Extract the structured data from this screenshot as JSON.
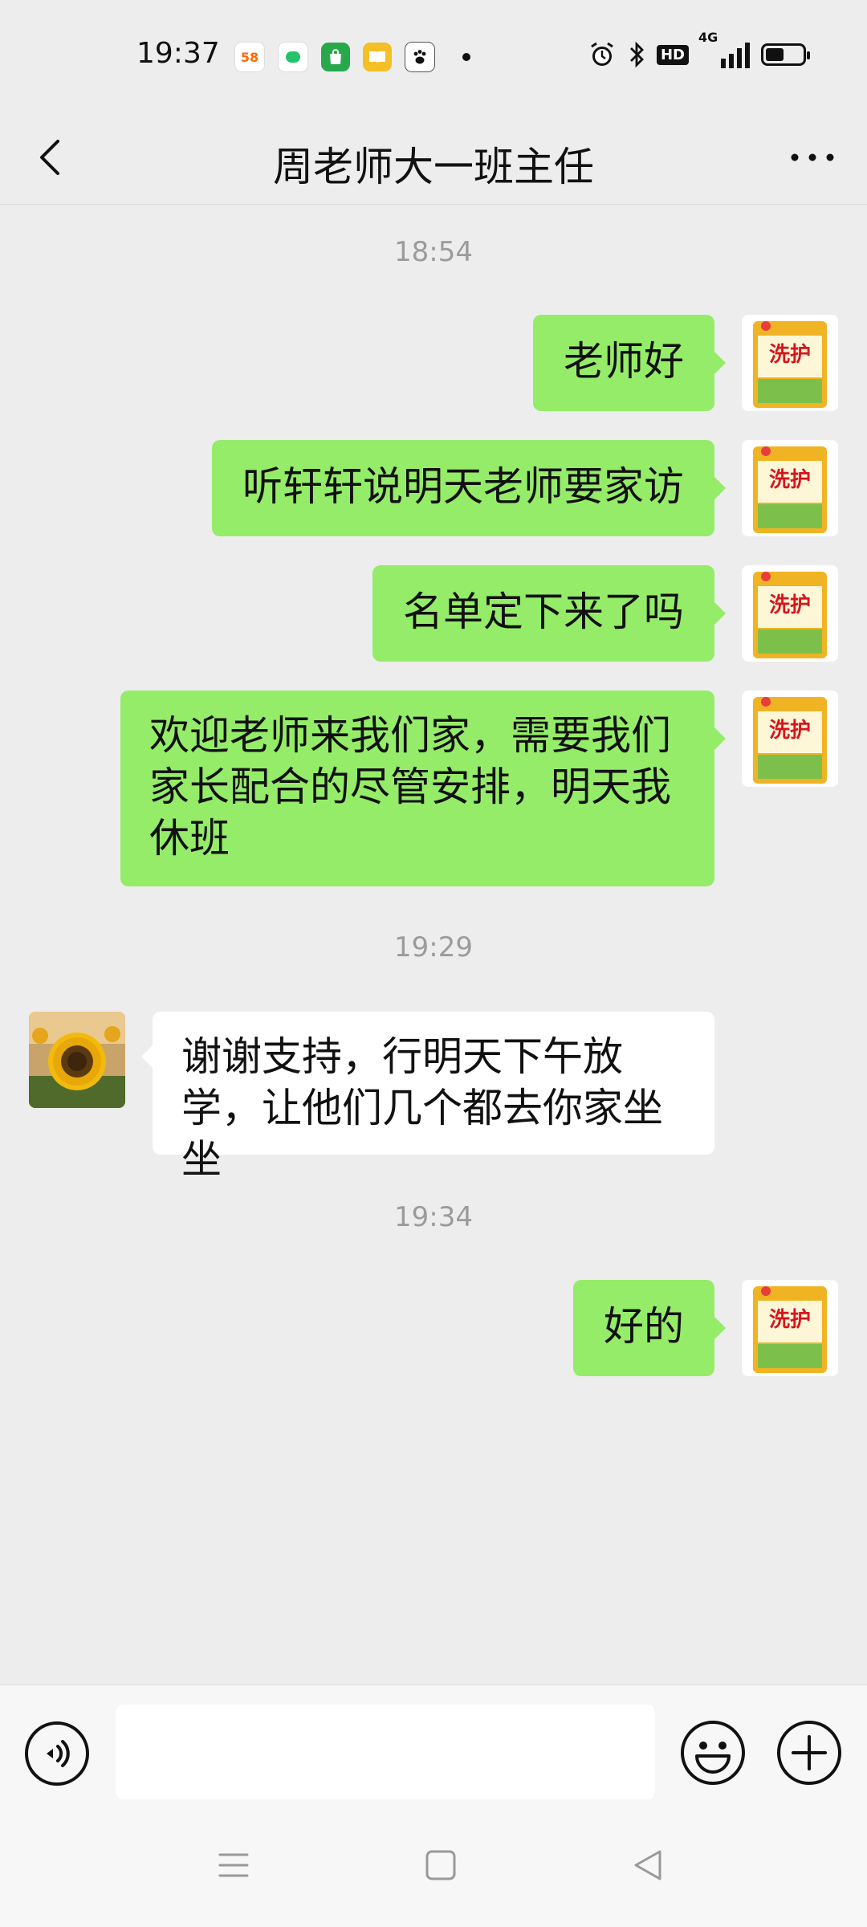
{
  "status_bar": {
    "time": "19:37",
    "app_icons": [
      "58-app-icon",
      "message-app-icon",
      "shopping-bag-icon",
      "book-app-icon",
      "baidu-paw-icon"
    ],
    "app_58_label": "58",
    "hd_label": "HD",
    "network_label": "4G",
    "battery_level": 0.5
  },
  "header": {
    "back_icon": "chevron-left-icon",
    "title": "周老师大一班主任",
    "more_icon": "more-dots-icon"
  },
  "chat": {
    "timestamps": [
      "18:54",
      "19:29",
      "19:34"
    ],
    "messages": [
      {
        "sender": "me",
        "text": "老师好"
      },
      {
        "sender": "me",
        "text": "听轩轩说明天老师要家访"
      },
      {
        "sender": "me",
        "text": "名单定下来了吗"
      },
      {
        "sender": "me",
        "text": "欢迎老师来我们家，需要我们家长配合的尽管安排，明天我休班"
      },
      {
        "sender": "other",
        "text": "谢谢支持，行明天下午放学，让他们几个都去你家坐坐"
      },
      {
        "sender": "me",
        "text": "好的"
      }
    ]
  },
  "input_bar": {
    "voice_icon": "voice-icon",
    "text_value": "",
    "emoji_icon": "emoji-icon",
    "plus_icon": "plus-icon"
  },
  "nav_bar": {
    "icons": [
      "menu-icon",
      "home-square-icon",
      "back-triangle-icon"
    ]
  },
  "colors": {
    "my_bubble": "#95ec69",
    "other_bubble": "#ffffff",
    "chat_background": "#ededed"
  }
}
